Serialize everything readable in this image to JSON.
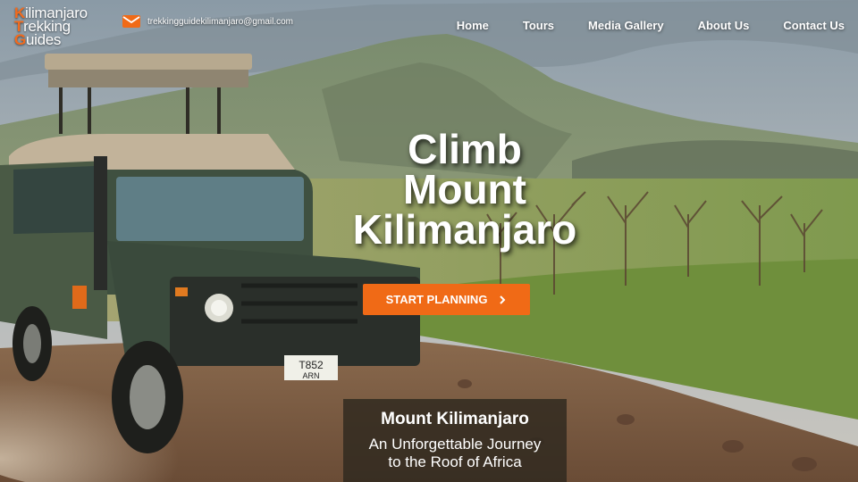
{
  "header": {
    "logo_lines": [
      {
        "cap": "K",
        "rest": "ilimanjaro"
      },
      {
        "cap": "T",
        "rest": "rekking"
      },
      {
        "cap": "G",
        "rest": "uides"
      }
    ],
    "email": "trekkingguidekilimanjaro@gmail.com",
    "email_icon": "envelope-icon"
  },
  "nav": {
    "items": [
      "Home",
      "Tours",
      "Media Gallery",
      "About Us",
      "Contact Us"
    ]
  },
  "hero": {
    "title_lines": [
      "Climb",
      "Mount",
      "Kilimanjaro"
    ],
    "cta_label": "START PLANNING",
    "cta_icon": "chevron-right-icon"
  },
  "caption": {
    "title": "Mount Kilimanjaro",
    "subtitle_lines": [
      "An Unforgettable Journey",
      "to the Roof of Africa"
    ]
  },
  "colors": {
    "accent": "#f06a16",
    "logo_cap": "#f26b1d",
    "caption_bg": "#2e281e"
  }
}
